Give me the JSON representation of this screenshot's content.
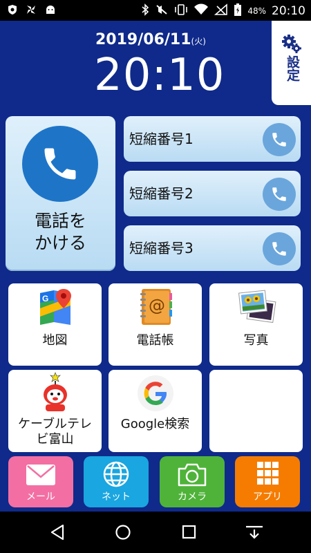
{
  "status": {
    "battery_pct": "48%",
    "time": "20:10",
    "left_icons": [
      "shield-icon",
      "pinwheel-icon",
      "android-icon"
    ],
    "right_icons": [
      "bluetooth-icon",
      "mute-icon",
      "vibrate-icon",
      "wifi-icon",
      "no-signal-icon",
      "battery-icon"
    ]
  },
  "header": {
    "date": "2019/06/11",
    "day_of_week": "(火)",
    "clock": "20:10",
    "settings_label": "設定"
  },
  "call_button": {
    "label": "電話を\nかける"
  },
  "speed_dials": [
    {
      "label": "短縮番号1"
    },
    {
      "label": "短縮番号2"
    },
    {
      "label": "短縮番号3"
    }
  ],
  "apps": [
    {
      "label": "地図",
      "icon": "google-maps-icon"
    },
    {
      "label": "電話帳",
      "icon": "address-book-icon"
    },
    {
      "label": "写真",
      "icon": "photos-icon"
    },
    {
      "label": "ケーブルテレ\nビ富山",
      "icon": "cable-tv-mascot-icon"
    },
    {
      "label": "Google検索",
      "icon": "google-g-icon"
    },
    {
      "label": "",
      "icon": ""
    }
  ],
  "bottom_bar": [
    {
      "label": "メール",
      "icon": "mail-icon",
      "color": "#f36fa3"
    },
    {
      "label": "ネット",
      "icon": "globe-icon",
      "color": "#1aa6e0"
    },
    {
      "label": "カメラ",
      "icon": "camera-icon",
      "color": "#4fb33a"
    },
    {
      "label": "アプリ",
      "icon": "apps-grid-icon",
      "color": "#f57c00"
    }
  ],
  "colors": {
    "background": "#0f2a8a",
    "call_circle": "#1e75c8",
    "speed_phone": "#6aa6dc"
  },
  "nav": [
    "back-icon",
    "home-icon",
    "recents-icon",
    "notifications-down-icon"
  ]
}
